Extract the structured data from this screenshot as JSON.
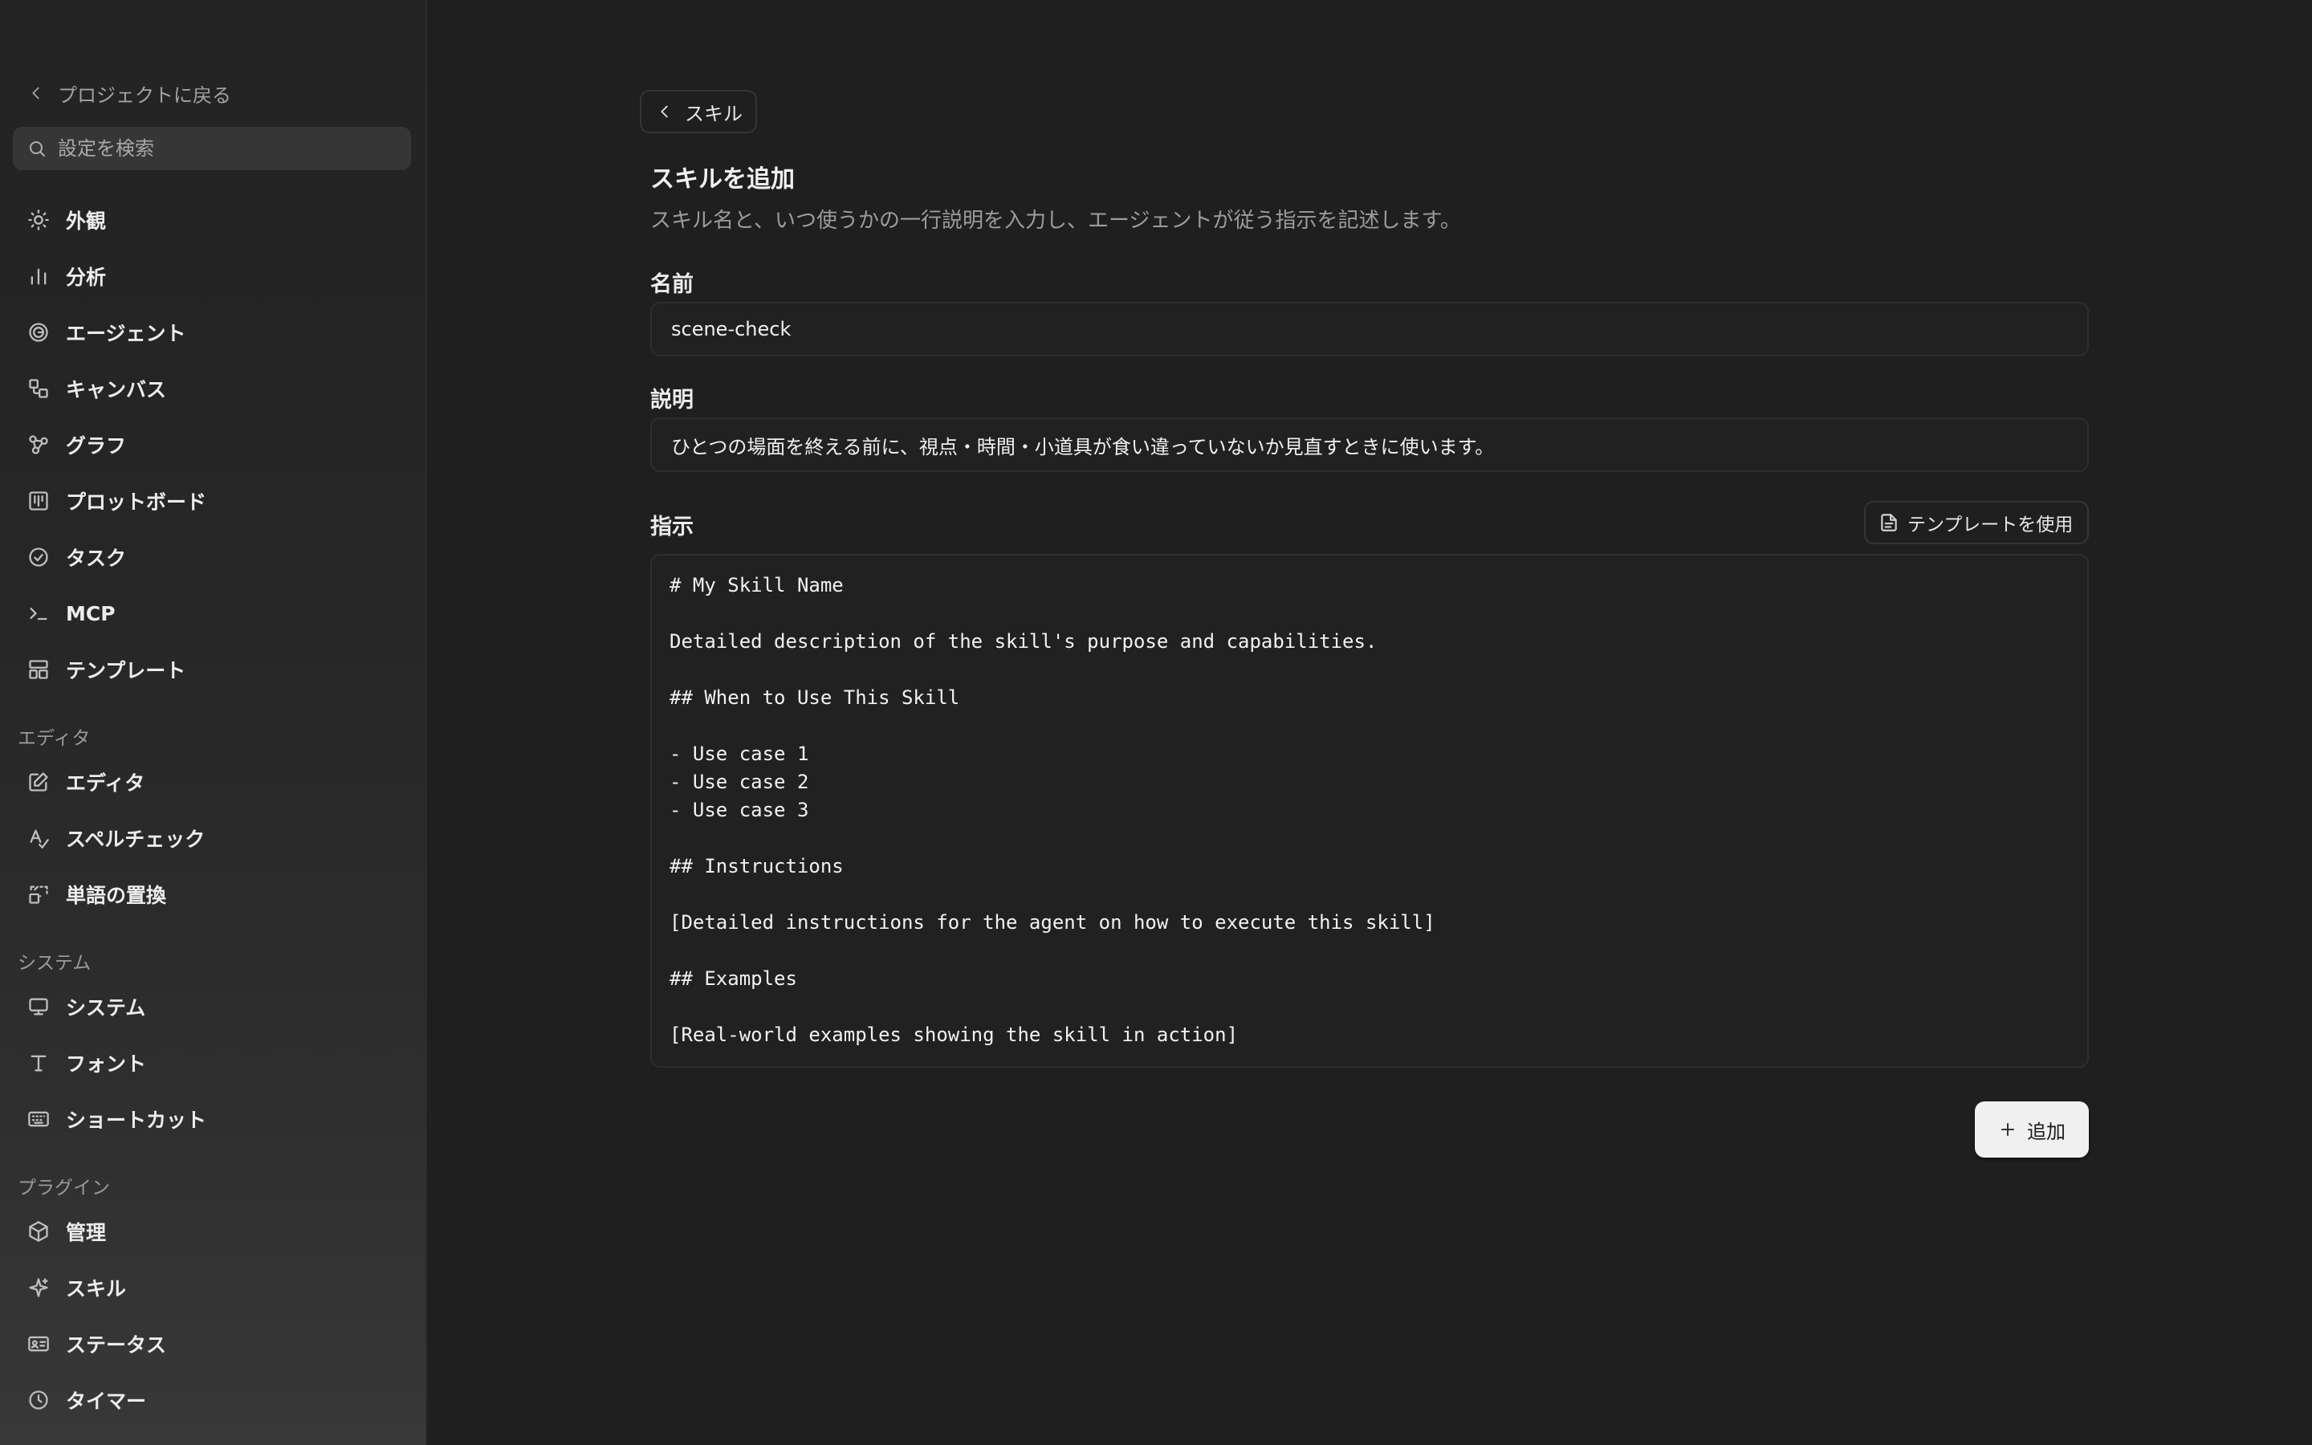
{
  "sidebar": {
    "back_label": "プロジェクトに戻る",
    "search_placeholder": "設定を検索",
    "items_top": [
      {
        "label": "外観",
        "icon": "sun-icon"
      },
      {
        "label": "分析",
        "icon": "bar-chart-icon"
      },
      {
        "label": "エージェント",
        "icon": "spiral-icon"
      },
      {
        "label": "キャンバス",
        "icon": "canvas-icon"
      },
      {
        "label": "グラフ",
        "icon": "graph-icon"
      },
      {
        "label": "プロットボード",
        "icon": "kanban-icon"
      },
      {
        "label": "タスク",
        "icon": "check-circle-icon"
      },
      {
        "label": "MCP",
        "icon": "terminal-icon"
      },
      {
        "label": "テンプレート",
        "icon": "layout-icon"
      }
    ],
    "section_editor": "エディタ",
    "items_editor": [
      {
        "label": "エディタ",
        "icon": "edit-icon"
      },
      {
        "label": "スペルチェック",
        "icon": "spellcheck-icon"
      },
      {
        "label": "単語の置換",
        "icon": "replace-icon"
      }
    ],
    "section_system": "システム",
    "items_system": [
      {
        "label": "システム",
        "icon": "monitor-icon"
      },
      {
        "label": "フォント",
        "icon": "type-icon"
      },
      {
        "label": "ショートカット",
        "icon": "keyboard-icon"
      }
    ],
    "section_plugins": "プラグイン",
    "items_plugins": [
      {
        "label": "管理",
        "icon": "package-icon"
      },
      {
        "label": "スキル",
        "icon": "sparkle-icon"
      },
      {
        "label": "ステータス",
        "icon": "id-card-icon"
      },
      {
        "label": "タイマー",
        "icon": "clock-icon"
      }
    ]
  },
  "main": {
    "breadcrumb": "スキル",
    "title": "スキルを追加",
    "subtitle": "スキル名と、いつ使うかの一行説明を入力し、エージェントが従う指示を記述します。",
    "name_label": "名前",
    "name_value": "scene-check",
    "description_label": "説明",
    "description_value": "ひとつの場面を終える前に、視点・時間・小道具が食い違っていないか見直すときに使います。",
    "instructions_label": "指示",
    "template_button": "テンプレートを使用",
    "instructions_value": "# My Skill Name\n\nDetailed description of the skill's purpose and capabilities.\n\n## When to Use This Skill\n\n- Use case 1\n- Use case 2\n- Use case 3\n\n## Instructions\n\n[Detailed instructions for the agent on how to execute this skill]\n\n## Examples\n\n[Real-world examples showing the skill in action]",
    "add_button": "追加"
  }
}
